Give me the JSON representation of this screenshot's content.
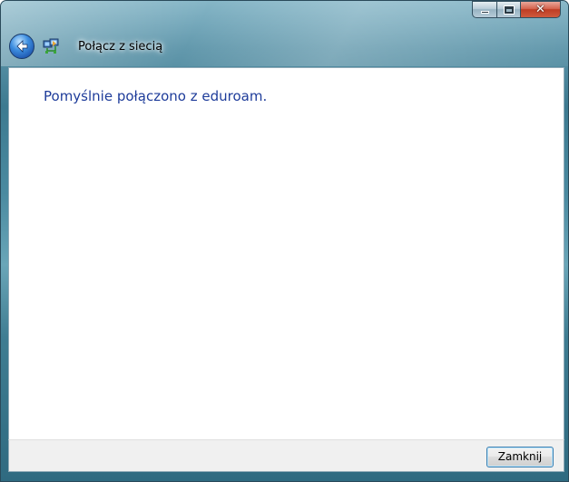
{
  "window": {
    "title": "Połącz z siecią"
  },
  "caption_buttons": {
    "minimize_icon": "minimize-icon",
    "maximize_icon": "maximize-icon",
    "close_glyph": "✕"
  },
  "navigation": {
    "back_icon": "back-arrow-icon",
    "wizard_icon": "network-connect-icon"
  },
  "content": {
    "message": "Pomyślnie połączono z eduroam."
  },
  "footer": {
    "close_label": "Zamknij"
  },
  "colors": {
    "message_text": "#1e3c9a",
    "button_border": "#3c7fb1",
    "footer_background": "#f0f0f0"
  }
}
